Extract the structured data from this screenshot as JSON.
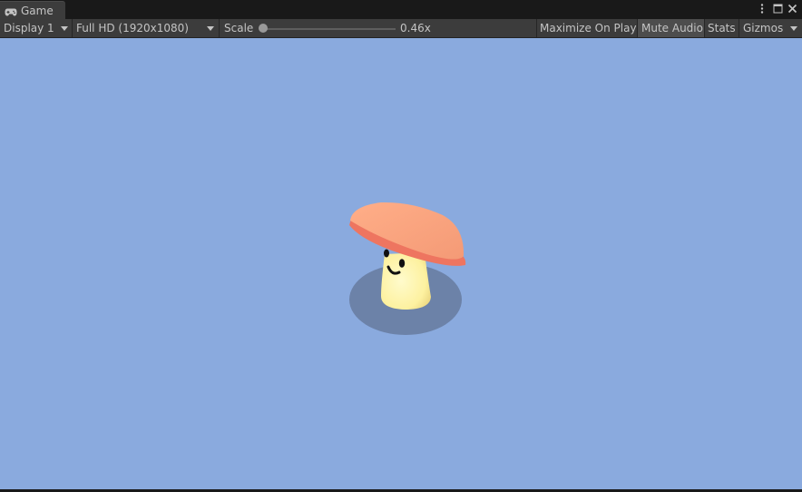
{
  "window": {
    "tab_label": "Game",
    "tab_icon": "gamepad-icon",
    "controls": [
      "kebab-menu-icon",
      "maximize-icon",
      "close-icon"
    ]
  },
  "toolbar": {
    "display": "Display 1",
    "resolution": "Full HD (1920x1080)",
    "scale_label": "Scale",
    "scale_value": "0.46x",
    "maximize_on_play": "Maximize On Play",
    "mute_audio": "Mute Audio",
    "stats": "Stats",
    "gizmos": "Gizmos"
  },
  "scene": {
    "background_color": "#8aaade",
    "object": "mushroom character",
    "cap_color": "#f6a07c",
    "stem_color": "#fdf6a8",
    "shadow_color": "#6a80a6"
  }
}
